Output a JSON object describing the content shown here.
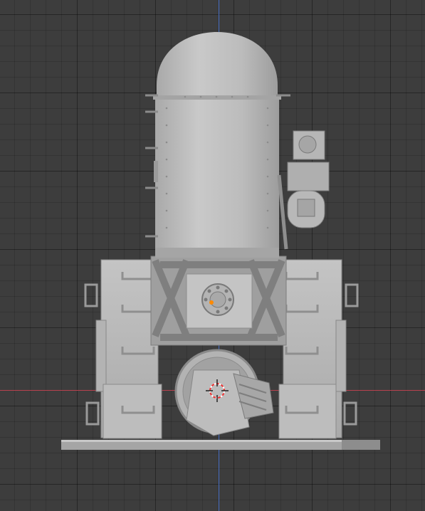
{
  "viewport": {
    "mode": "orthographic-front",
    "grid": true
  },
  "colors": {
    "background": "#3d3d3d",
    "x_axis": "#b8414f",
    "z_axis": "#4d73c6",
    "model": "#b9b9b9",
    "origin_dot": "#ff8a00"
  },
  "icons": {
    "cursor": "3d-cursor-icon",
    "origin": "object-origin-icon"
  }
}
